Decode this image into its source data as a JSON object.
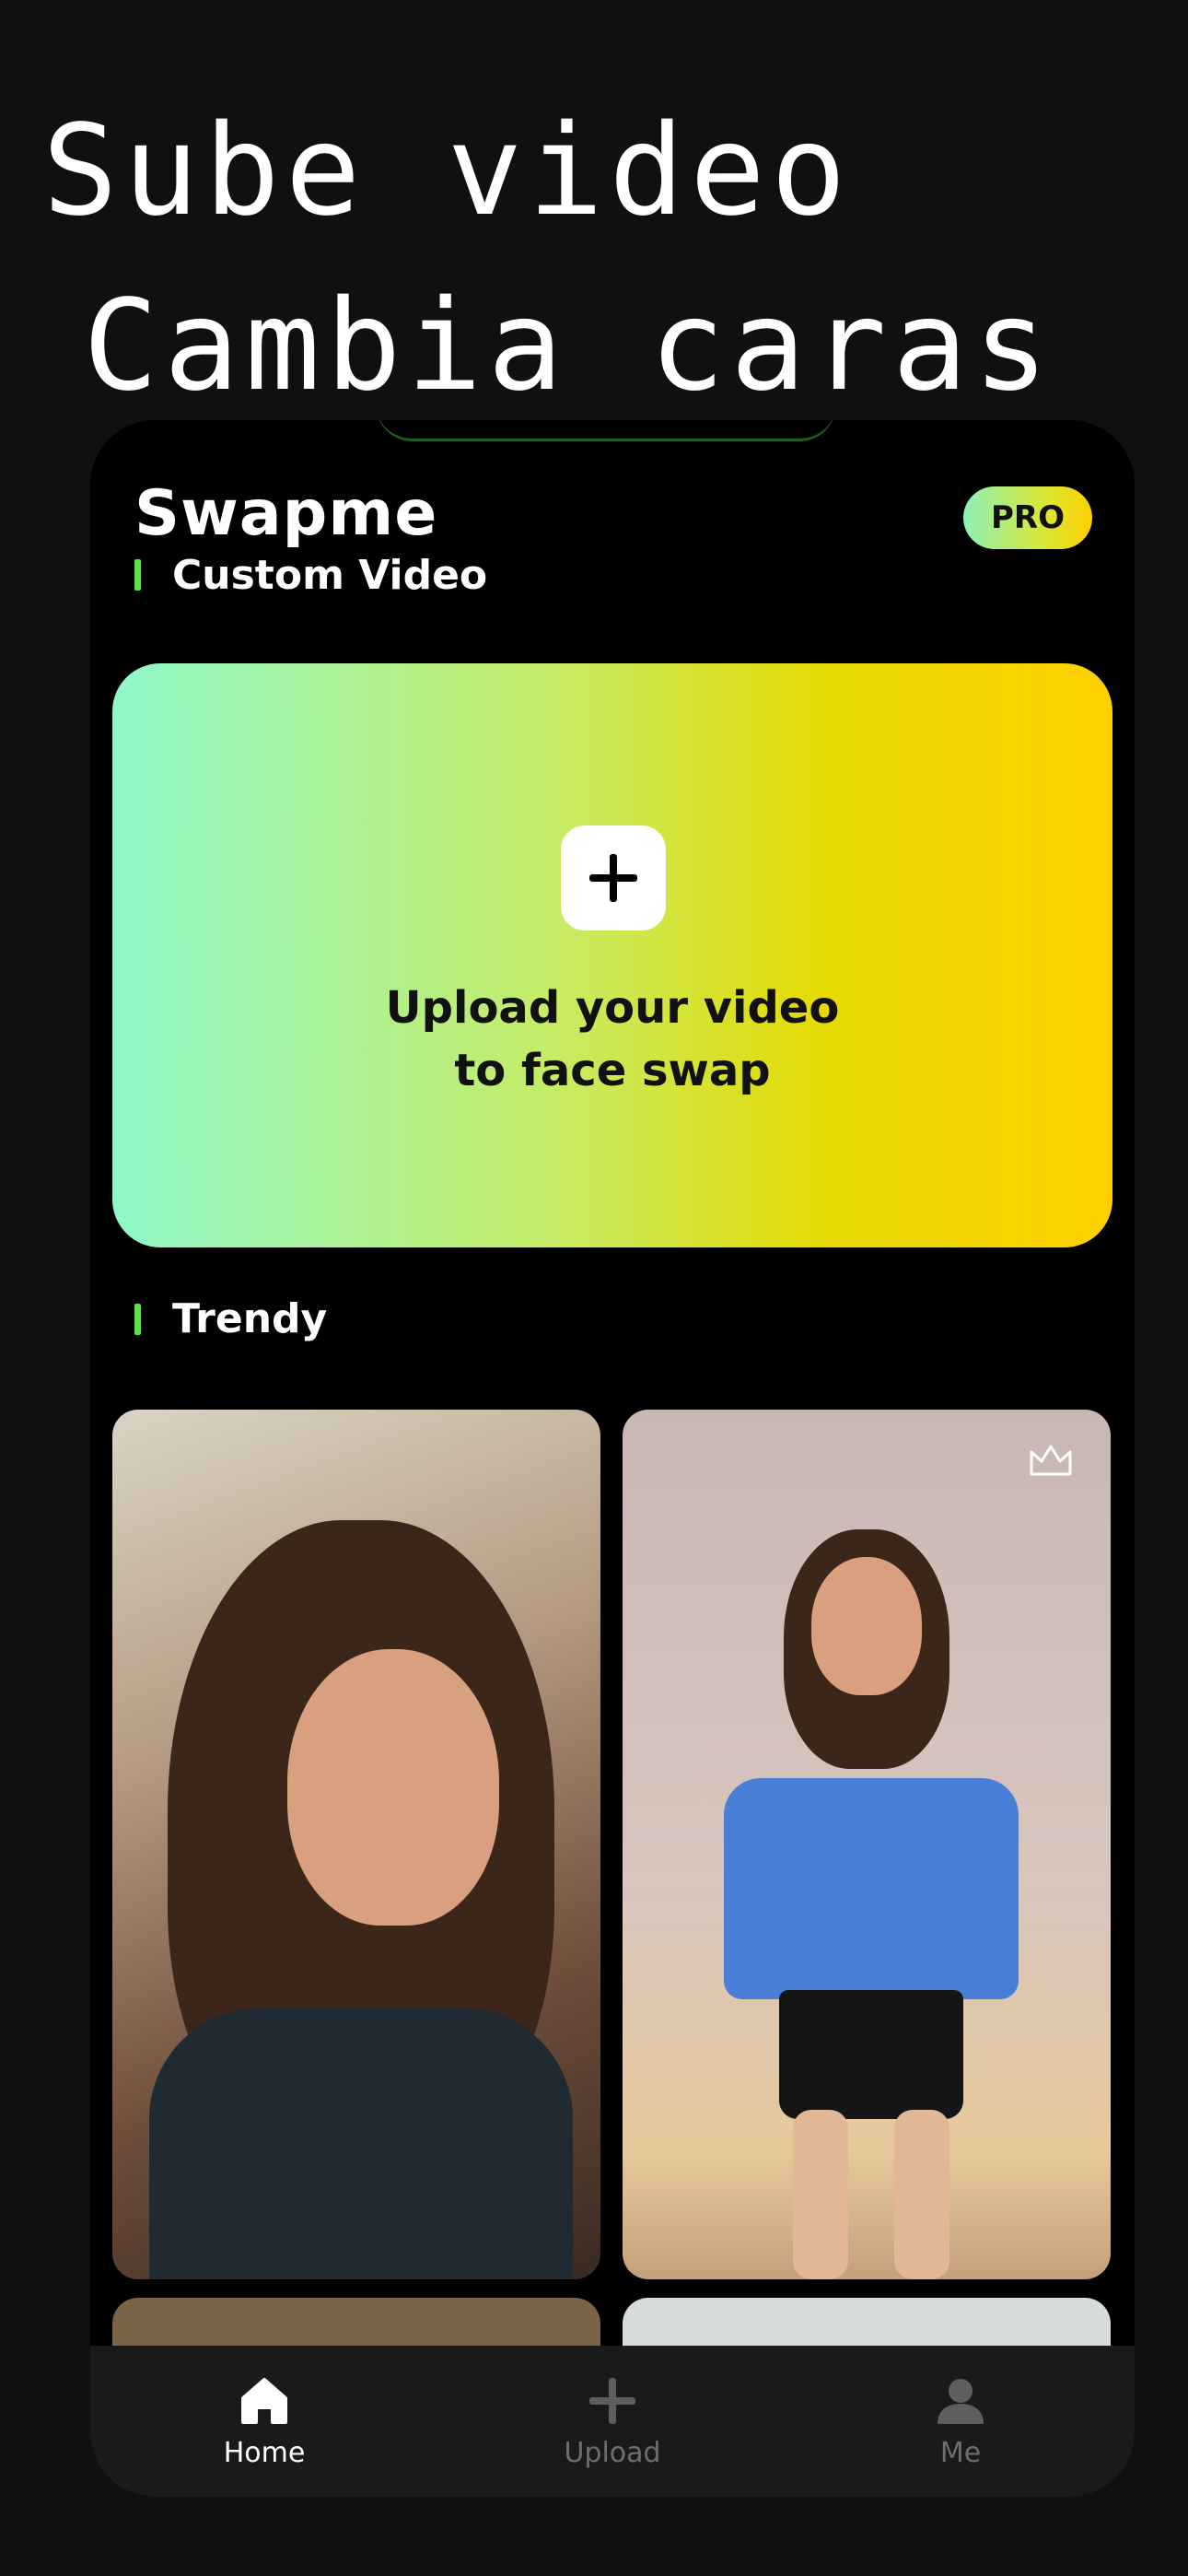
{
  "promo": {
    "line1": "Sube video",
    "line2": "Cambia caras"
  },
  "header": {
    "title": "Swapme",
    "pro_label": "PRO"
  },
  "sections": {
    "custom_title": "Custom Video",
    "trendy_title": "Trendy"
  },
  "upload_card": {
    "line1": "Upload your video",
    "line2": "to face swap"
  },
  "bottom_nav": [
    {
      "label": "Home",
      "icon": "home-icon",
      "active": true
    },
    {
      "label": "Upload",
      "icon": "plus-icon",
      "active": false
    },
    {
      "label": "Me",
      "icon": "person-icon",
      "active": false
    }
  ],
  "colors": {
    "accent_green": "#5fe04a",
    "gradient_start": "#8ef8c9",
    "gradient_end": "#ffd000",
    "background": "#000000"
  }
}
